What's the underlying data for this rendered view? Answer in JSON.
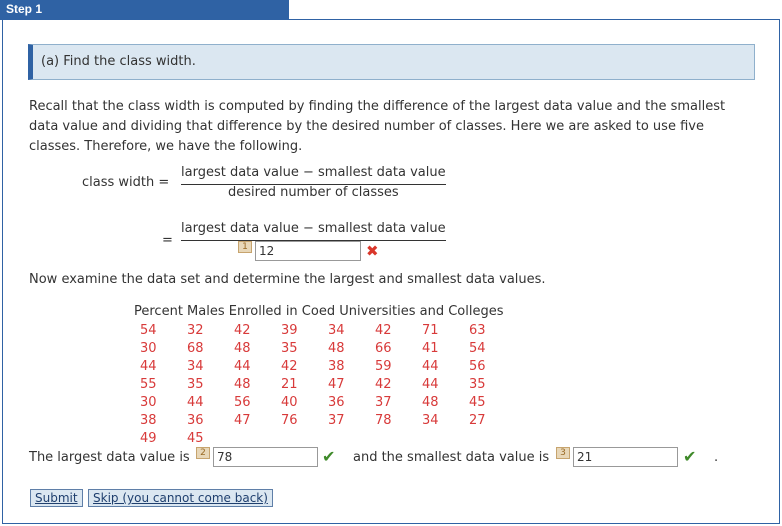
{
  "step_tab": "Step 1",
  "header": "(a) Find the class width.",
  "intro": "Recall that the class width is computed by finding the difference of the largest data value and the smallest data value and dividing that difference by the desired number of classes. Here we are asked to use five classes. Therefore, we have the following.",
  "formula": {
    "label": "class width =",
    "numerator": "largest data value − smallest data value",
    "denominator": "desired number of classes",
    "equals": "=",
    "numerator2": "largest data value − smallest data value",
    "input1_badge": "1",
    "input1_value": "12"
  },
  "instruction2": "Now examine the data set and determine the largest and smallest data values.",
  "dataset": {
    "title": "Percent Males Enrolled in Coed Universities and Colleges",
    "values": [
      "54",
      "32",
      "42",
      "39",
      "34",
      "42",
      "71",
      "63",
      "30",
      "68",
      "48",
      "35",
      "48",
      "66",
      "41",
      "54",
      "44",
      "34",
      "44",
      "42",
      "38",
      "59",
      "44",
      "56",
      "55",
      "35",
      "48",
      "21",
      "47",
      "42",
      "44",
      "35",
      "30",
      "44",
      "56",
      "40",
      "36",
      "37",
      "48",
      "45",
      "38",
      "36",
      "47",
      "76",
      "37",
      "78",
      "34",
      "27",
      "49",
      "45"
    ]
  },
  "answer_line": {
    "prefix": "The largest data value is",
    "badge2": "2",
    "largest": "78",
    "middle": "and the smallest data value is",
    "badge3": "3",
    "smallest": "21",
    "period": "."
  },
  "buttons": {
    "submit": "Submit",
    "skip": "Skip (you cannot come back)"
  },
  "icons": {
    "wrong": "x-mark-icon",
    "correct": "check-mark-icon"
  },
  "colors": {
    "accent": "#2f62a4",
    "data": "#d83a3a",
    "wrong": "#d9372b",
    "correct": "#3f8a2a"
  }
}
